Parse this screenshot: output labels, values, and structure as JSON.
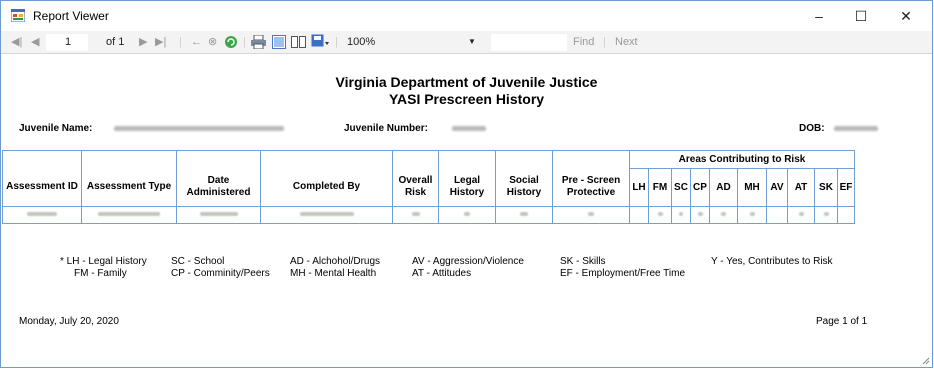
{
  "window": {
    "title": "Report Viewer",
    "minimize": "–",
    "maximize": "☐",
    "close": "✕"
  },
  "toolbar": {
    "page_current": "1",
    "page_of": "of 1",
    "zoom": "100%",
    "find_label": "Find",
    "separator": "|",
    "next_label": "Next"
  },
  "report": {
    "title_line1": "Virginia Department of Juvenile Justice",
    "title_line2": "YASI Prescreen History",
    "juvenile_name_label": "Juvenile Name:",
    "juvenile_number_label": "Juvenile Number:",
    "dob_label": "DOB:",
    "areas_header": "Areas Contributing to Risk",
    "columns": [
      "Assessment ID",
      "Assessment Type",
      "Date Administered",
      "Completed By",
      "Overall Risk",
      "Legal History",
      "Social History",
      "Pre - Screen Protective"
    ],
    "area_columns": [
      "LH",
      "FM",
      "SC",
      "CP",
      "AD",
      "MH",
      "AV",
      "AT",
      "SK",
      "EF"
    ],
    "legend": [
      "* LH - Legal History",
      "FM - Family",
      "SC - School",
      "CP - Comminity/Peers",
      "AD - Alchohol/Drugs",
      "MH - Mental Health",
      "AV - Aggression/Violence",
      "AT - Attitudes",
      "SK - Skills",
      "EF - Employment/Free Time",
      "Y - Yes, Contributes to Risk"
    ],
    "date_footer": "Monday, July 20, 2020",
    "page_footer": "Page 1 of 1"
  }
}
